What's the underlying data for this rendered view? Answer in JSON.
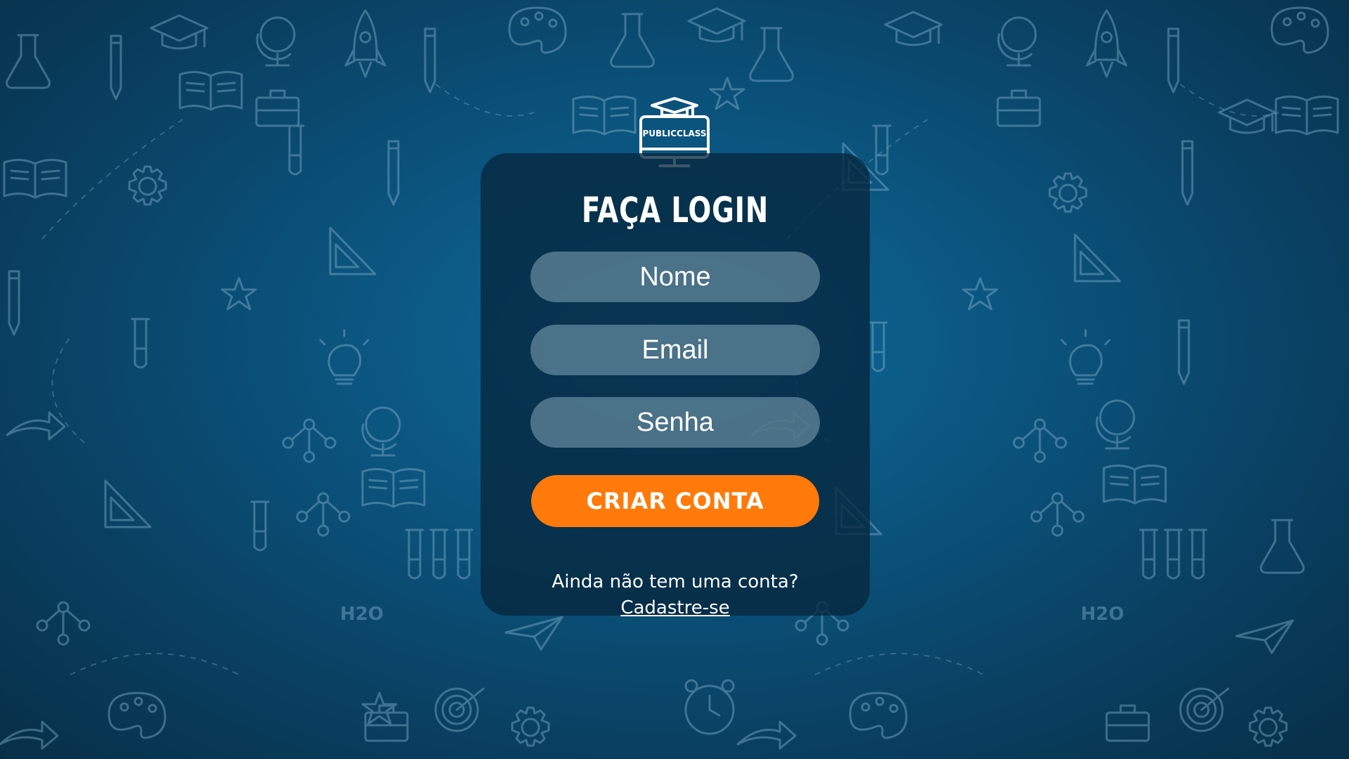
{
  "logo": {
    "text": "PUBLICCLASS",
    "icon": "graduation-cap-monitor-icon"
  },
  "form": {
    "title": "FAÇA LOGIN",
    "name_placeholder": "Nome",
    "email_placeholder": "Email",
    "password_placeholder": "Senha",
    "submit_label": "CRIAR CONTA"
  },
  "signup": {
    "prompt": "Ainda não tem uma conta?",
    "link_label": "Cadastre-se"
  },
  "background": {
    "pattern": "school-doodles",
    "chemistry_label": "H2O"
  },
  "colors": {
    "background": "#0b557f",
    "card": "#06263e",
    "accent": "#ff7a0a",
    "field": "#aac8d7",
    "text": "#ffffff"
  }
}
